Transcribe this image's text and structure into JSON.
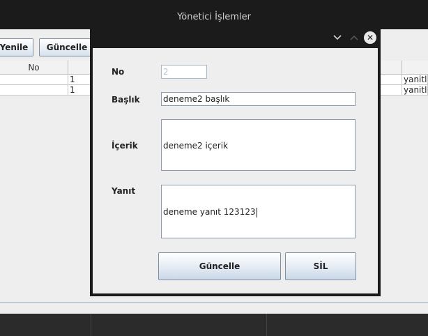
{
  "window": {
    "title": "Yönetici İşlemler"
  },
  "toolbar": {
    "refresh_label": "Yenile",
    "update_label": "Güncelle"
  },
  "table": {
    "header_no": "No",
    "rows": [
      {
        "count": "1",
        "status": "yanitla"
      },
      {
        "count": "1",
        "status": "yanitla"
      }
    ]
  },
  "dialog": {
    "icons": {
      "minimize": "chevron-down-icon",
      "maximize": "chevron-up-icon",
      "close": "close-icon"
    },
    "no_label": "No",
    "no_value": "2",
    "subject_label": "Başlık",
    "subject_value": "deneme2 başlık",
    "content_label": "İçerik",
    "content_value": "deneme2 içerik",
    "reply_label": "Yanıt",
    "reply_value": "deneme yanıt 123123",
    "update_label": "Güncelle",
    "delete_label": "SİL"
  }
}
